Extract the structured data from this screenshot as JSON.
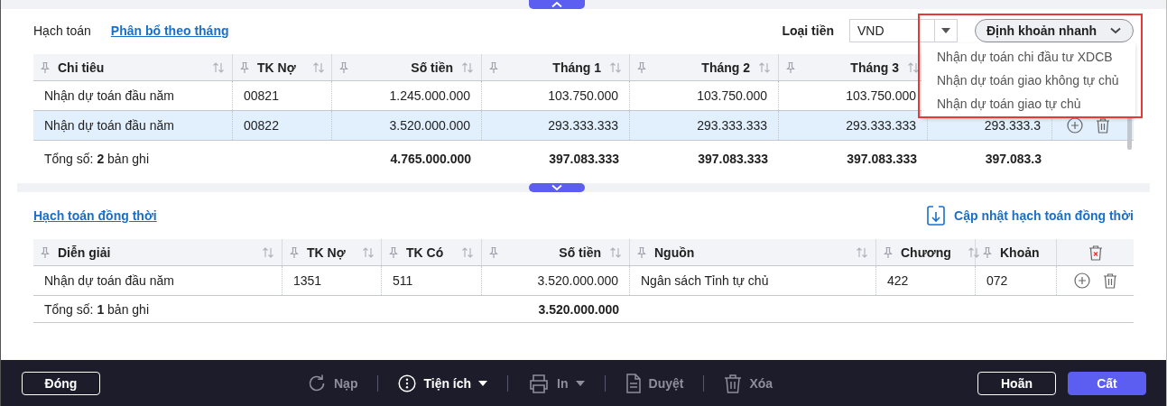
{
  "top_section": {
    "tabs": [
      {
        "label": "Hạch toán",
        "selected": true
      },
      {
        "label": "Phân bổ theo tháng",
        "selected": false
      }
    ],
    "currency": {
      "label": "Loại tiền",
      "value": "VND"
    },
    "quick_entry": {
      "label": "Định khoản nhanh",
      "expanded": true,
      "items": [
        "Nhận dự toán chi đầu tư XDCB",
        "Nhận dự toán giao không tự chủ",
        "Nhận dự toán giao tự chủ"
      ]
    },
    "table": {
      "columns": [
        {
          "label": "Chi tiêu",
          "sortable": true
        },
        {
          "label": "TK Nợ",
          "sortable": true
        },
        {
          "label": "Số tiền",
          "sortable": true
        },
        {
          "label": "Tháng 1",
          "sortable": true
        },
        {
          "label": "Tháng 2",
          "sortable": true
        },
        {
          "label": "Tháng 3",
          "sortable": true
        }
      ],
      "rows": [
        {
          "selected": false,
          "cells": [
            "Nhận dự toán đầu năm",
            "00821",
            "1.245.000.000",
            "103.750.000",
            "103.750.000",
            "103.750.000"
          ]
        },
        {
          "selected": true,
          "actions": true,
          "cells": [
            "Nhận dự toán đầu năm",
            "00822",
            "3.520.000.000",
            "293.333.333",
            "293.333.333",
            "293.333.333",
            "293.333.3"
          ]
        }
      ],
      "total": {
        "label": "Tổng số: **2** bản ghi",
        "values": [
          "4.765.000.000",
          "397.083.333",
          "397.083.333",
          "397.083.333",
          "397.083.3"
        ]
      }
    }
  },
  "concurrent_section": {
    "title": "Hạch toán đồng thời",
    "update_link": "Cập nhật hạch toán đồng thời",
    "table": {
      "columns": [
        {
          "label": "Diễn giải",
          "sortable": true
        },
        {
          "label": "TK Nợ",
          "sortable": true
        },
        {
          "label": "TK Có",
          "sortable": true
        },
        {
          "label": "Số tiền",
          "sortable": true
        },
        {
          "label": "Nguồn",
          "sortable": true
        },
        {
          "label": "Chương",
          "sortable": true
        },
        {
          "label": "Khoản",
          "sortable": false
        }
      ],
      "rows": [
        {
          "selected": false,
          "actions": true,
          "cells": [
            "Nhận dự toán đầu năm",
            "1351",
            "511",
            "3.520.000.000",
            "Ngân sách Tỉnh tự chủ",
            "422",
            "072"
          ]
        }
      ],
      "total": {
        "label": "Tổng số: **1** bản ghi",
        "values": [
          "3.520.000.000"
        ]
      }
    }
  },
  "footer": {
    "left_buttons": [
      {
        "label": "Đóng",
        "kind": "outline"
      }
    ],
    "tools": [
      {
        "label": "Nạp",
        "disabled": true,
        "has_menu": false
      },
      {
        "label": "Tiện ích",
        "disabled": false,
        "has_menu": true
      },
      {
        "label": "In",
        "disabled": true,
        "has_menu": true
      },
      {
        "label": "Duyệt",
        "disabled": true,
        "has_menu": false
      },
      {
        "label": "Xóa",
        "disabled": true,
        "has_menu": false
      }
    ],
    "right_buttons": [
      {
        "label": "Hoãn",
        "kind": "outline"
      },
      {
        "label": "Cất",
        "kind": "primary"
      }
    ]
  }
}
